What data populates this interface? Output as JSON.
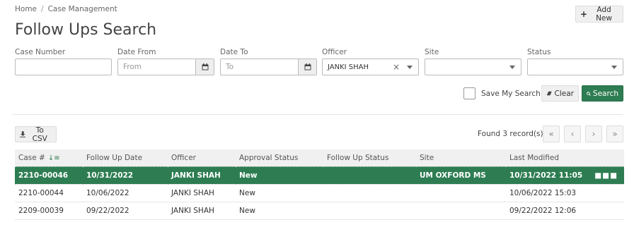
{
  "breadcrumb": {
    "home": "Home",
    "separator": "/",
    "current": "Case Management"
  },
  "page": {
    "title": "Follow Ups Search"
  },
  "toolbar": {
    "add_new_label": "Add New"
  },
  "filters": {
    "case_number": {
      "label": "Case Number",
      "value": ""
    },
    "date_from": {
      "label": "Date From",
      "placeholder": "From"
    },
    "date_to": {
      "label": "Date To",
      "placeholder": "To"
    },
    "officer": {
      "label": "Officer",
      "value": "JANKI SHAH"
    },
    "site": {
      "label": "Site",
      "value": ""
    },
    "status": {
      "label": "Status",
      "value": ""
    },
    "save_my_search": {
      "label": "Save My Search",
      "checked": false
    },
    "clear_label": "Clear",
    "search_label": "Search"
  },
  "results": {
    "csv_label": "To CSV",
    "found_text": "Found 3 record(s)",
    "pager": {
      "first": "«",
      "prev": "‹",
      "next": "›",
      "last": "»"
    },
    "columns": [
      "Case #",
      "Follow Up Date",
      "Officer",
      "Approval Status",
      "Follow Up Status",
      "Site",
      "Last Modified"
    ],
    "rows": [
      {
        "case": "2210-00046",
        "date": "10/31/2022",
        "officer": "JANKI SHAH",
        "approval": "New",
        "followup": "",
        "site": "UM OXFORD MS",
        "modified": "10/31/2022 11:05",
        "selected": true
      },
      {
        "case": "2210-00044",
        "date": "10/06/2022",
        "officer": "JANKI SHAH",
        "approval": "New",
        "followup": "",
        "site": "",
        "modified": "10/06/2022 15:03",
        "selected": false
      },
      {
        "case": "2209-00039",
        "date": "09/22/2022",
        "officer": "JANKI SHAH",
        "approval": "New",
        "followup": "",
        "site": "",
        "modified": "09/22/2022 12:06",
        "selected": false
      }
    ]
  },
  "icons": {
    "plus": "plus-icon",
    "calendar": "calendar-icon",
    "eraser": "eraser-icon",
    "search": "search-icon",
    "download": "download-icon",
    "sort": "sort-icon",
    "more": "more-icon"
  },
  "colors": {
    "accent": "#2e7d52"
  }
}
